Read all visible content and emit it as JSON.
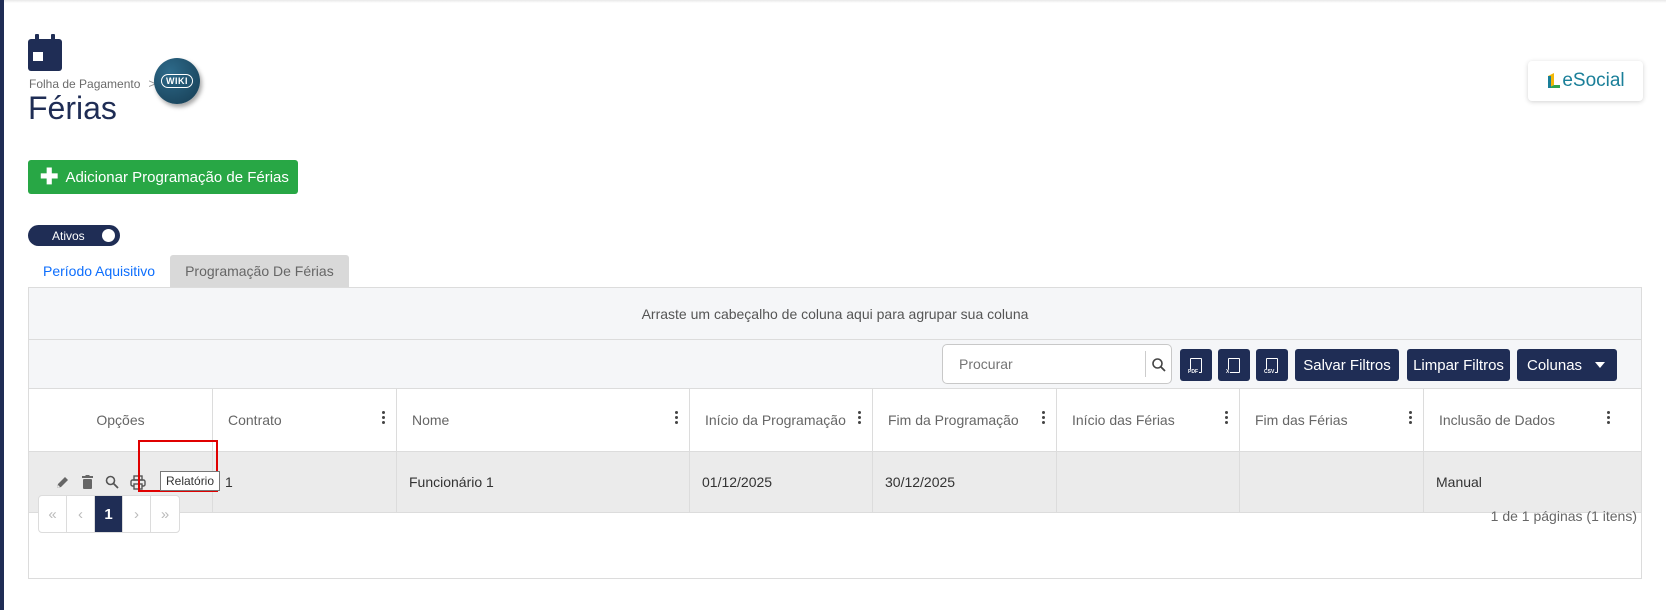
{
  "breadcrumb": {
    "section": "Folha de Pagamento",
    "separator": ">"
  },
  "wiki": {
    "label": "WIKI"
  },
  "page": {
    "title": "Férias"
  },
  "esocial": {
    "label": "eSocial"
  },
  "actions": {
    "add_label": "Adicionar Programação de Férias"
  },
  "toggle": {
    "label": "Ativos",
    "on": true
  },
  "tabs": [
    {
      "label": "Período Aquisitivo",
      "active": true
    },
    {
      "label": "Programação De Férias",
      "active": false
    }
  ],
  "grid": {
    "group_hint": "Arraste um cabeçalho de coluna aqui para agrupar sua coluna",
    "search_placeholder": "Procurar",
    "toolbar": {
      "save_filters": "Salvar Filtros",
      "clear_filters": "Limpar Filtros",
      "columns": "Colunas"
    },
    "export_icons": [
      "PDF",
      "X",
      "CSV"
    ],
    "columns": [
      "Opções",
      "Contrato",
      "Nome",
      "Início da Programação",
      "Fim da Programação",
      "Início das Férias",
      "Fim das Férias",
      "Inclusão de Dados"
    ],
    "rows": [
      {
        "contrato": "1",
        "nome": "Funcionário 1",
        "inicio_programacao": "01/12/2025",
        "fim_programacao": "30/12/2025",
        "inicio_ferias": "",
        "fim_ferias": "",
        "inclusao": "Manual"
      }
    ],
    "row_icons": [
      "edit-icon",
      "trash-icon",
      "search-icon",
      "print-icon"
    ],
    "tooltip": "Relatório",
    "pager": {
      "first": "«",
      "prev": "‹",
      "current": "1",
      "next": "›",
      "last": "»",
      "info": "1 de 1 páginas (1 itens)"
    }
  },
  "colors": {
    "primary": "#1f2d55",
    "success": "#28a745",
    "tab_active": "#0d6efd",
    "highlight": "#e00000"
  }
}
